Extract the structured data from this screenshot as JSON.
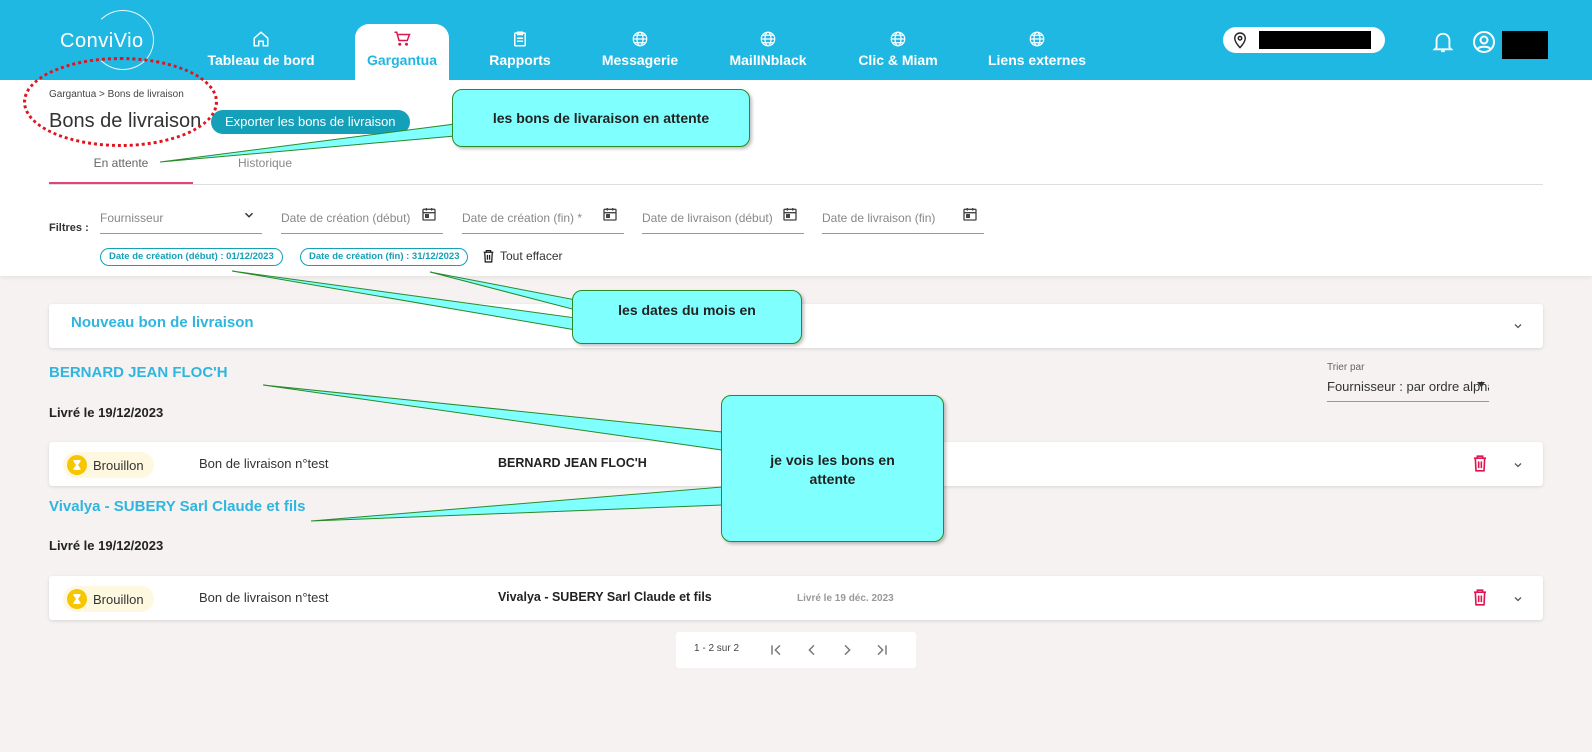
{
  "app": {
    "logo": "ConviVio"
  },
  "nav": {
    "items": [
      {
        "label": "Tableau de bord",
        "icon": "home-icon"
      },
      {
        "label": "Gargantua",
        "icon": "cart-icon",
        "active": true
      },
      {
        "label": "Rapports",
        "icon": "clipboard-icon"
      },
      {
        "label": "Messagerie",
        "icon": "globe-icon"
      },
      {
        "label": "MailINblack",
        "icon": "globe-icon"
      },
      {
        "label": "Clic & Miam",
        "icon": "globe-icon"
      },
      {
        "label": "Liens externes",
        "icon": "globe-icon"
      }
    ]
  },
  "header": {
    "breadcrumb": "Gargantua > Bons de livraison",
    "title": "Bons de livraison",
    "export_label": "Exporter les bons de livraison"
  },
  "tabs": [
    {
      "label": "En attente",
      "active": true
    },
    {
      "label": "Historique"
    }
  ],
  "filters": {
    "label": "Filtres :",
    "fields": [
      {
        "placeholder": "Fournisseur"
      },
      {
        "placeholder": "Date de création (début)"
      },
      {
        "placeholder": "Date de création (fin) *"
      },
      {
        "placeholder": "Date de livraison (début)"
      },
      {
        "placeholder": "Date de livraison (fin)"
      }
    ],
    "chips": [
      "Date de création (début) : 01/12/2023",
      "Date de création (fin) : 31/12/2023"
    ],
    "clear_all": "Tout effacer"
  },
  "new_bl": "Nouveau bon de livraison",
  "sort": {
    "label": "Trier par",
    "value": "Fournisseur : par ordre alphabétique"
  },
  "groups": [
    {
      "supplier": "BERNARD JEAN FLOC'H",
      "delivered": "Livré le 19/12/2023",
      "row": {
        "status": "Brouillon",
        "number": "Bon de livraison n°test",
        "supplier": "BERNARD JEAN FLOC'H",
        "date": ""
      }
    },
    {
      "supplier": "Vivalya - SUBERY Sarl Claude et fils",
      "delivered": "Livré le 19/12/2023",
      "row": {
        "status": "Brouillon",
        "number": "Bon de livraison n°test",
        "supplier": "Vivalya - SUBERY Sarl Claude et fils",
        "date": "Livré le 19 déc. 2023"
      }
    }
  ],
  "pager": {
    "range": "1 - 2 sur 2"
  },
  "annotations": {
    "a1": "les bons de livaraison en attente",
    "a2": "les dates du mois en",
    "a3": "je vois les bons en attente"
  },
  "colors": {
    "brand": "#1fb8e3",
    "accent": "#14a0b8",
    "tab_underline": "#e0447a",
    "delete": "#e0144f",
    "annotation": "#80ffff"
  }
}
